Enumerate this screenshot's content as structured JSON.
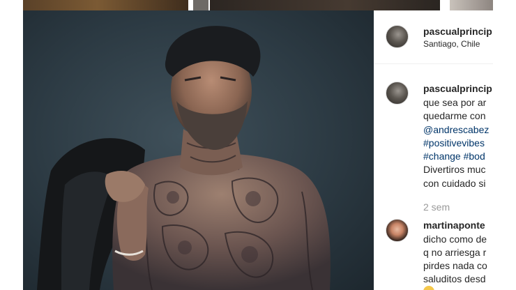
{
  "post": {
    "author": {
      "username": "pascualprincip",
      "location": "Santiago, Chile",
      "avatar_icon": "profile-avatar"
    },
    "caption": {
      "username": "pascualprincip",
      "lines": [
        "que sea por ar",
        "quedarme con"
      ],
      "mention": "@andrescabez",
      "hashtag_line1": "#positivevibes",
      "hashtag_line2": "#change #bod",
      "line_after_1": "Divertiros muc",
      "line_after_2": "con cuidado si"
    },
    "time_ago": "2 sem"
  },
  "comments": [
    {
      "username": "martinaponte",
      "lines": [
        "dicho como de",
        "q no arriesga r",
        "pirdes nada co",
        "saluditos desd"
      ],
      "emoji_icon": "emoji-icon"
    }
  ],
  "colors": {
    "link": "#003569",
    "text": "#262626",
    "muted": "#999999",
    "photo_background": "#2c3a43"
  }
}
